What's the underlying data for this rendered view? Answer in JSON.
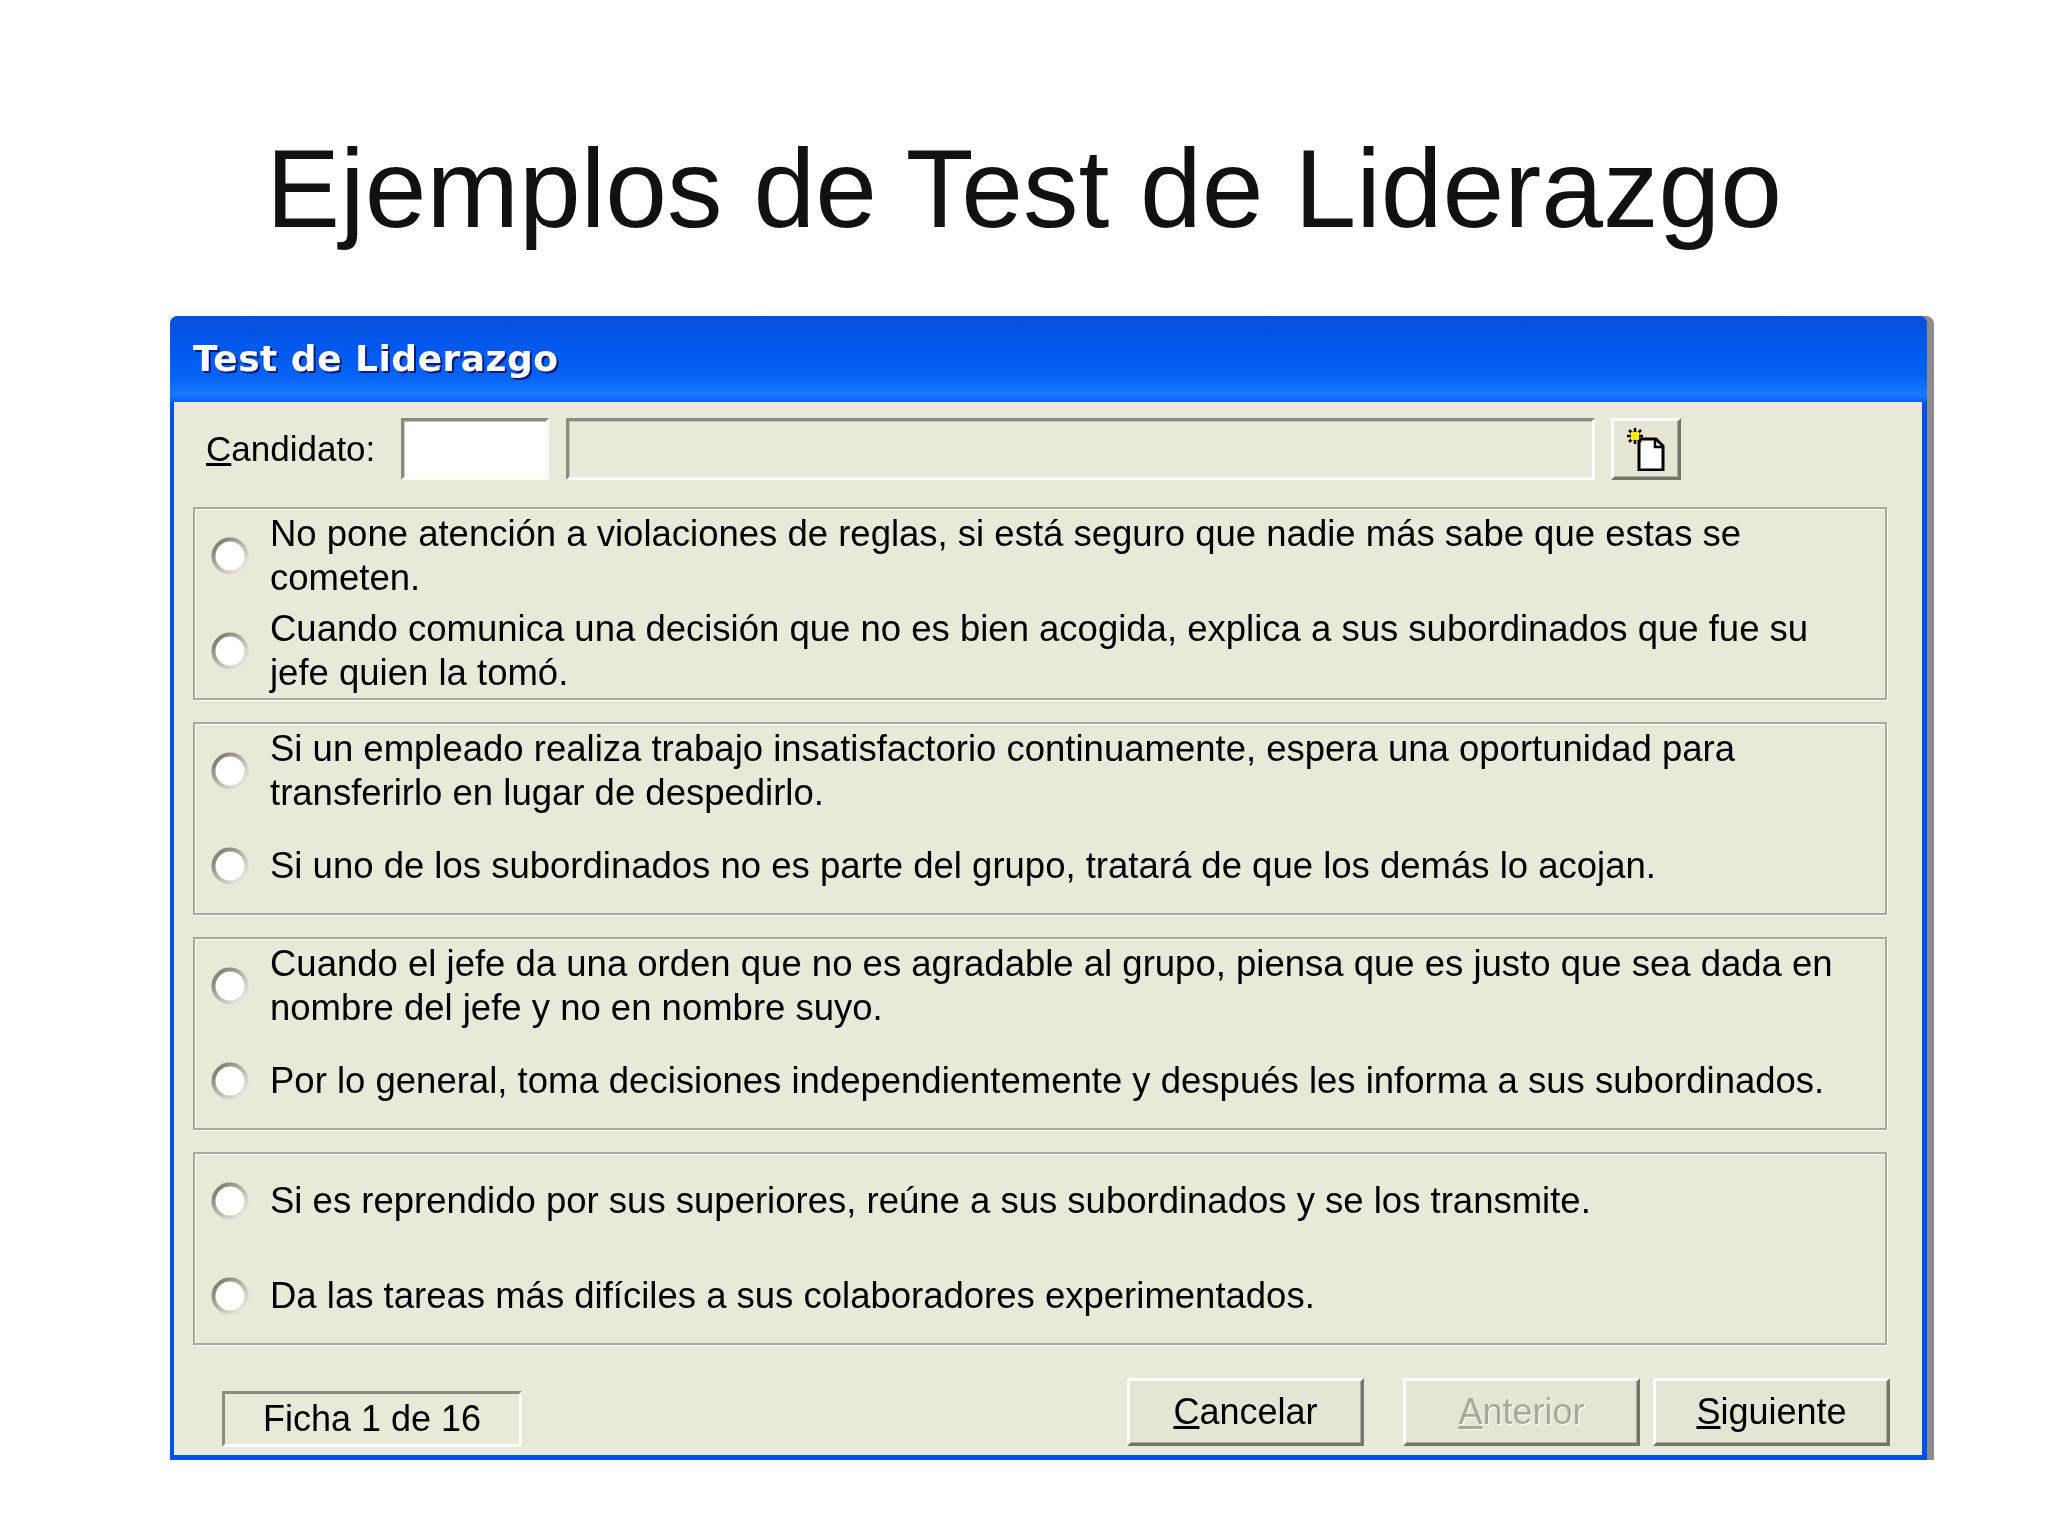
{
  "slide_title": "Ejemplos de Test de Liderazgo",
  "window": {
    "title": "Test de Liderazgo"
  },
  "candidate": {
    "label": "Candidato:",
    "access_key": true,
    "fields": [
      {
        "disabled": false
      },
      {
        "disabled": true
      }
    ]
  },
  "question_groups": [
    {
      "options": [
        {
          "text": "No pone atención a violaciones de reglas, si está seguro que nadie más sabe que estas se cometen.",
          "selected": false
        },
        {
          "text": "Cuando comunica una decisión que no es bien acogida, explica a sus subordinados que fue su jefe quien la tomó.",
          "selected": false
        }
      ]
    },
    {
      "options": [
        {
          "text": "Si un empleado realiza trabajo insatisfactorio continuamente, espera una oportunidad para transferirlo en lugar de despedirlo.",
          "selected": false
        },
        {
          "text": "Si uno de los subordinados no es parte del grupo, tratará de que los demás lo acojan.",
          "selected": false
        }
      ]
    },
    {
      "options": [
        {
          "text": "Cuando el jefe da una orden que no es agradable al grupo, piensa que es justo que sea dada en nombre del jefe y no en nombre suyo.",
          "selected": false
        },
        {
          "text": "Por lo general, toma decisiones independientemente y después les informa a sus subordinados.",
          "selected": false
        }
      ]
    },
    {
      "options": [
        {
          "text": "Si es reprendido por sus superiores, reúne a sus subordinados y se los transmite.",
          "selected": false
        },
        {
          "text": "Da las tareas más difíciles a sus colaboradores experimentados.",
          "selected": false
        }
      ]
    }
  ],
  "status": "Ficha 1 de 16",
  "buttons": [
    {
      "label": "Cancelar",
      "kind": "cancel",
      "disabled": false,
      "access_key": true
    },
    {
      "label": "Anterior",
      "kind": "nav",
      "disabled": true,
      "access_key": true
    },
    {
      "label": "Siguiente",
      "kind": "nav",
      "disabled": false,
      "access_key": true
    }
  ]
}
